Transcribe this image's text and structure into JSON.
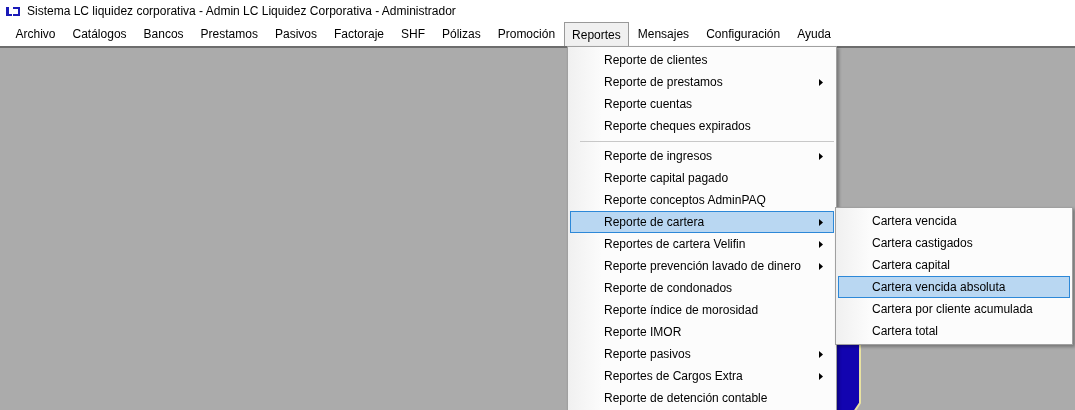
{
  "window": {
    "title": "Sistema LC liquidez corporativa - Admin LC Liquidez Corporativa - Administrador"
  },
  "menu_bar": [
    {
      "label": "Archivo",
      "selected": false
    },
    {
      "label": "Catálogos",
      "selected": false
    },
    {
      "label": "Bancos",
      "selected": false
    },
    {
      "label": "Prestamos",
      "selected": false
    },
    {
      "label": "Pasivos",
      "selected": false
    },
    {
      "label": "Factoraje",
      "selected": false
    },
    {
      "label": "SHF",
      "selected": false
    },
    {
      "label": "Pólizas",
      "selected": false
    },
    {
      "label": "Promoción",
      "selected": false
    },
    {
      "label": "Reportes",
      "selected": true
    },
    {
      "label": "Mensajes",
      "selected": false
    },
    {
      "label": "Configuración",
      "selected": false
    },
    {
      "label": "Ayuda",
      "selected": false
    }
  ],
  "reportes_menu": [
    {
      "kind": "item",
      "label": "Reporte de clientes",
      "selected": false
    },
    {
      "kind": "submenu",
      "label": "Reporte de prestamos",
      "selected": false
    },
    {
      "kind": "item",
      "label": "Reporte cuentas",
      "selected": false
    },
    {
      "kind": "item",
      "label": "Reporte cheques expirados",
      "selected": false
    },
    {
      "kind": "separator"
    },
    {
      "kind": "submenu",
      "label": "Reporte de ingresos",
      "selected": false
    },
    {
      "kind": "item",
      "label": "Reporte capital pagado",
      "selected": false
    },
    {
      "kind": "item",
      "label": "Reporte conceptos AdminPAQ",
      "selected": false
    },
    {
      "kind": "submenu",
      "label": "Reporte de cartera",
      "selected": true
    },
    {
      "kind": "submenu",
      "label": "Reportes de cartera Velifin",
      "selected": false
    },
    {
      "kind": "submenu",
      "label": "Reporte prevención lavado de dinero",
      "selected": false
    },
    {
      "kind": "item",
      "label": "Reporte de condonados",
      "selected": false
    },
    {
      "kind": "item",
      "label": "Reporte índice de morosidad",
      "selected": false
    },
    {
      "kind": "item",
      "label": "Reporte IMOR",
      "selected": false
    },
    {
      "kind": "submenu",
      "label": "Reporte pasivos",
      "selected": false
    },
    {
      "kind": "submenu",
      "label": "Reportes de Cargos Extra",
      "selected": false
    },
    {
      "kind": "item",
      "label": "Reporte de detención contable",
      "selected": false
    }
  ],
  "cartera_submenu": [
    {
      "kind": "item",
      "label": "Cartera vencida",
      "selected": false
    },
    {
      "kind": "item",
      "label": "Cartera castigados",
      "selected": false
    },
    {
      "kind": "item",
      "label": "Cartera capital",
      "selected": false
    },
    {
      "kind": "item",
      "label": "Cartera vencida absoluta",
      "selected": true
    },
    {
      "kind": "item",
      "label": "Cartera por cliente acumulada",
      "selected": false
    },
    {
      "kind": "item",
      "label": "Cartera total",
      "selected": false
    }
  ]
}
